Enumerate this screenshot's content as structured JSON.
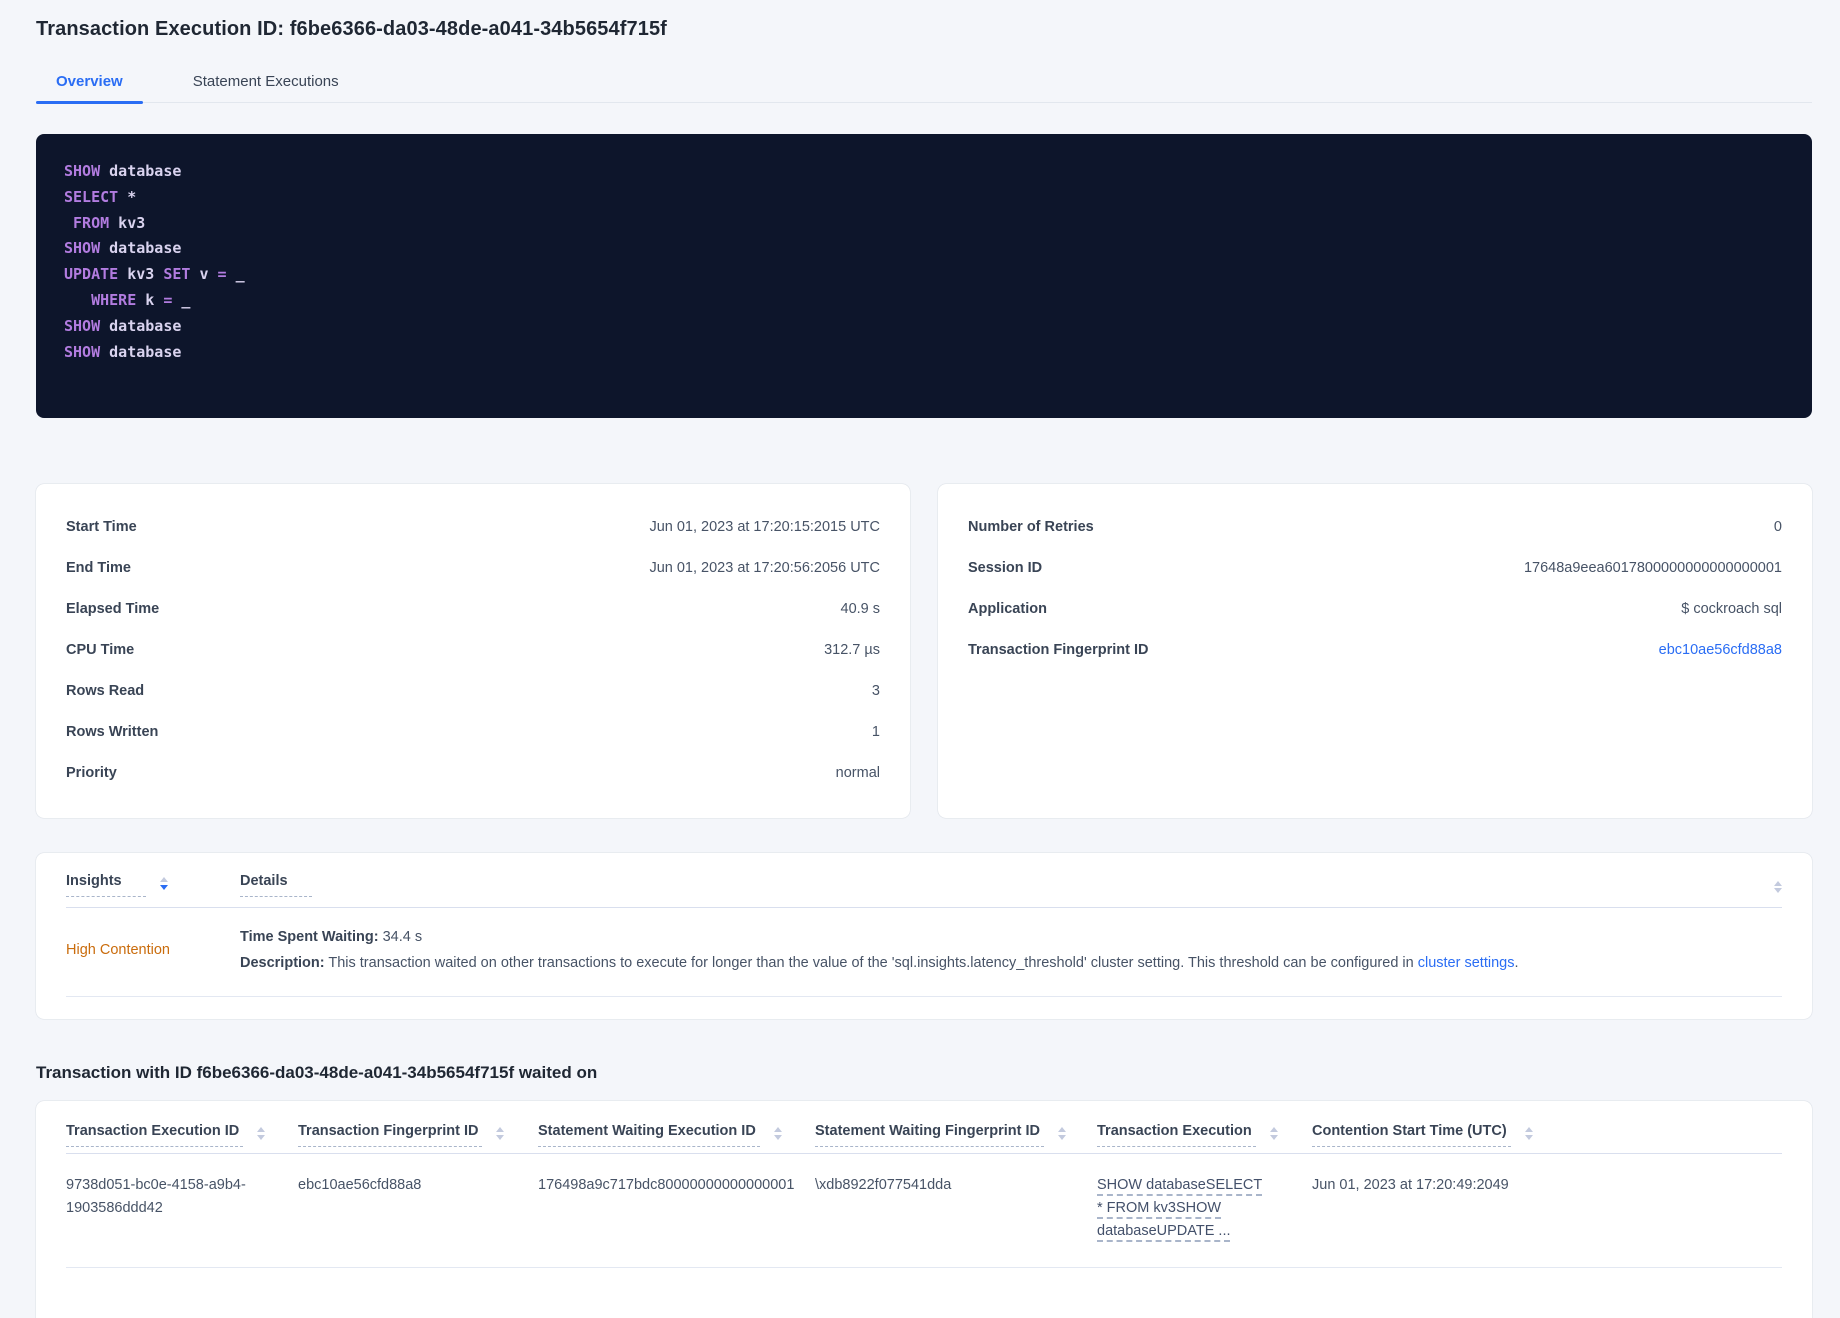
{
  "page": {
    "title": "Transaction Execution ID: f6be6366-da03-48de-a041-34b5654f715f"
  },
  "tabs": [
    {
      "label": "Overview",
      "active": true
    },
    {
      "label": "Statement Executions",
      "active": false
    }
  ],
  "sql": {
    "lines": [
      [
        {
          "c": "kw",
          "t": "SHOW"
        },
        {
          "c": "plain",
          "t": " database"
        }
      ],
      [
        {
          "c": "kw",
          "t": "SELECT"
        },
        {
          "c": "plain",
          "t": " *"
        }
      ],
      [
        {
          "c": "plain",
          "t": " "
        },
        {
          "c": "kw",
          "t": "FROM"
        },
        {
          "c": "plain",
          "t": " kv3"
        }
      ],
      [
        {
          "c": "kw",
          "t": "SHOW"
        },
        {
          "c": "plain",
          "t": " database"
        }
      ],
      [
        {
          "c": "kw",
          "t": "UPDATE"
        },
        {
          "c": "plain",
          "t": " kv3 "
        },
        {
          "c": "kw",
          "t": "SET"
        },
        {
          "c": "plain",
          "t": " v "
        },
        {
          "c": "kw",
          "t": "="
        },
        {
          "c": "plain",
          "t": " _"
        }
      ],
      [
        {
          "c": "plain",
          "t": "   "
        },
        {
          "c": "kw",
          "t": "WHERE"
        },
        {
          "c": "plain",
          "t": " k "
        },
        {
          "c": "kw",
          "t": "="
        },
        {
          "c": "plain",
          "t": " _"
        }
      ],
      [
        {
          "c": "kw",
          "t": "SHOW"
        },
        {
          "c": "plain",
          "t": " database"
        }
      ],
      [
        {
          "c": "kw",
          "t": "SHOW"
        },
        {
          "c": "plain",
          "t": " database"
        }
      ]
    ]
  },
  "summary_left": {
    "rows": [
      {
        "label": "Start Time",
        "value": "Jun 01, 2023 at 17:20:15:2015 UTC"
      },
      {
        "label": "End Time",
        "value": "Jun 01, 2023 at 17:20:56:2056 UTC"
      },
      {
        "label": "Elapsed Time",
        "value": "40.9 s"
      },
      {
        "label": "CPU Time",
        "value": "312.7 µs"
      },
      {
        "label": "Rows Read",
        "value": "3"
      },
      {
        "label": "Rows Written",
        "value": "1"
      },
      {
        "label": "Priority",
        "value": "normal"
      }
    ]
  },
  "summary_right": {
    "rows": [
      {
        "label": "Number of Retries",
        "value": "0"
      },
      {
        "label": "Session ID",
        "value": "17648a9eea6017800000000000000001"
      },
      {
        "label": "Application",
        "value": "$ cockroach sql"
      },
      {
        "label": "Transaction Fingerprint ID",
        "value": "ebc10ae56cfd88a8",
        "link": true
      }
    ]
  },
  "insights": {
    "columns": [
      "Insights",
      "Details"
    ],
    "row": {
      "insight": "High Contention",
      "time_label": "Time Spent Waiting:",
      "time_value": " 34.4 s",
      "desc_label": "Description:",
      "desc_text": " This transaction waited on other transactions to execute for longer than the value of the 'sql.insights.latency_threshold' cluster setting. This threshold can be configured in ",
      "desc_link": "cluster settings",
      "desc_suffix": "."
    }
  },
  "waited_section": {
    "heading": "Transaction with ID f6be6366-da03-48de-a041-34b5654f715f waited on",
    "columns": [
      "Transaction Execution ID",
      "Transaction Fingerprint ID",
      "Statement Waiting Execution ID",
      "Statement Waiting Fingerprint ID",
      "Transaction Execution",
      "Contention Start Time (UTC)"
    ],
    "row": {
      "txn_exec_id": "9738d051-bc0e-4158-a9b4-1903586ddd42",
      "txn_fingerprint_id": "ebc10ae56cfd88a8",
      "stmt_waiting_exec_id": "176498a9c717bdc80000000000000001",
      "stmt_waiting_fingerprint_id": "\\xdb8922f077541dda",
      "txn_execution": "SHOW databaseSELECT * FROM kv3SHOW databaseUPDATE ...",
      "contention_start": "Jun 01, 2023 at 17:20:49:2049"
    }
  },
  "colors": {
    "accent_blue": "#2a6df4",
    "insight_orange": "#ca6c0c",
    "code_background": "#0d152b",
    "code_keyword": "#b27ce0",
    "code_plain": "#d9d3ef"
  }
}
